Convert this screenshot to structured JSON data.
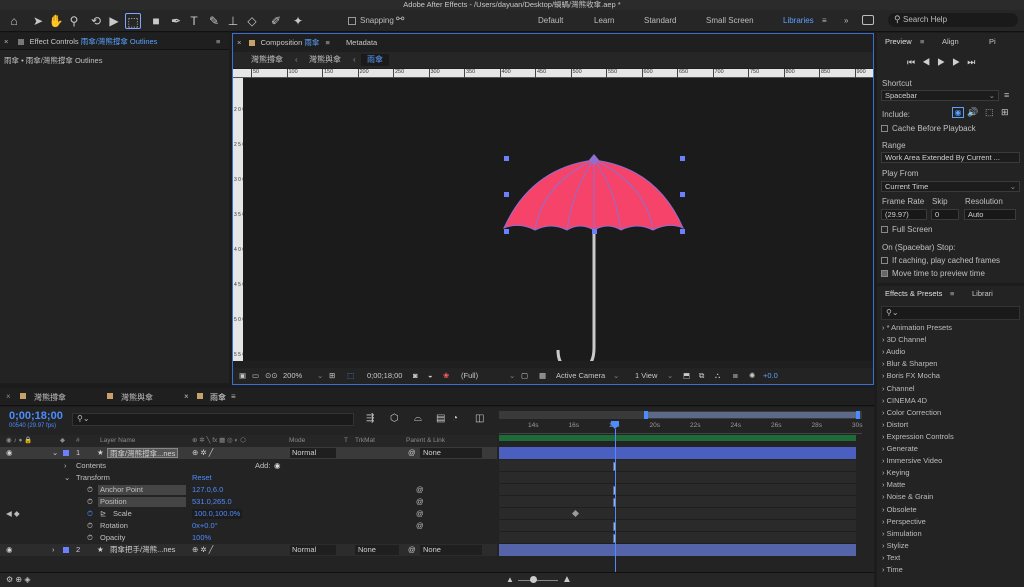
{
  "window": {
    "title": "Adobe After Effects - /Users/dayuan/Desktop/蝸蝸/灣熊收傘.aep *"
  },
  "toolbar": {
    "snapping_label": "Snapping",
    "workspaces": [
      "Default",
      "Learn",
      "Standard",
      "Small Screen",
      "Libraries"
    ],
    "active_workspace": "Libraries",
    "search_placeholder": "Search Help"
  },
  "effect_controls": {
    "tab_label": "Effect Controls",
    "tab_layer": "雨傘/灣熊撐傘 Outlines",
    "subtitle": "雨傘 • 雨傘/灣熊撐傘 Outlines"
  },
  "composition": {
    "tab_label": "Composition",
    "tab_comp": "雨傘",
    "metadata_tab": "Metadata",
    "breadcrumbs": [
      "灣熊撐傘",
      "灣熊與傘",
      "雨傘"
    ],
    "ruler_ticks": [
      "50",
      "100",
      "150",
      "200",
      "250",
      "300",
      "350",
      "400",
      "450",
      "500",
      "550",
      "600",
      "650",
      "700",
      "750",
      "800",
      "850",
      "900"
    ],
    "vruler_ticks": [
      "2 0 0",
      "2 5 0",
      "3 0 0",
      "3 5 0",
      "4 0 0",
      "4 5 0",
      "5 0 0",
      "5 5 0"
    ],
    "zoom": "200%",
    "timecode": "0;00;18;00",
    "resolution": "(Full)",
    "camera": "Active Camera",
    "view": "1 View",
    "exposure": "+0.0"
  },
  "preview": {
    "tabs": [
      "Preview",
      "Align",
      "Pi"
    ],
    "shortcut_label": "Shortcut",
    "shortcut_value": "Spacebar",
    "include_label": "Include:",
    "cache_label": "Cache Before Playback",
    "range_label": "Range",
    "range_value": "Work Area Extended By Current ...",
    "play_from_label": "Play From",
    "play_from_value": "Current Time",
    "frame_rate_label": "Frame Rate",
    "skip_label": "Skip",
    "resolution_label": "Resolution",
    "frame_rate_value": "(29.97)",
    "skip_value": "0",
    "resolution_value": "Auto",
    "full_screen_label": "Full Screen",
    "stop_label": "On (Spacebar) Stop:",
    "if_caching_label": "If caching, play cached frames",
    "move_time_label": "Move time to preview time"
  },
  "effects": {
    "tabs": [
      "Effects & Presets",
      "Librari"
    ],
    "items": [
      "* Animation Presets",
      "3D Channel",
      "Audio",
      "Blur & Sharpen",
      "Boris FX Mocha",
      "Channel",
      "CINEMA 4D",
      "Color Correction",
      "Distort",
      "Expression Controls",
      "Generate",
      "Immersive Video",
      "Keying",
      "Matte",
      "Noise & Grain",
      "Obsolete",
      "Perspective",
      "Simulation",
      "Stylize",
      "Text",
      "Time"
    ]
  },
  "timeline": {
    "tabs": [
      "灣熊撐傘",
      "灣熊與傘",
      "雨傘"
    ],
    "current_time": "0;00;18;00",
    "frame_info": "00540 (29.97 fps)",
    "ruler": [
      "14s",
      "16s",
      "18s",
      "20s",
      "22s",
      "24s",
      "26s",
      "28s",
      "30s"
    ],
    "col_headers": {
      "num": "#",
      "layer": "Layer Name",
      "mode": "Mode",
      "t": "T",
      "trkmat": "TrkMat",
      "parent": "Parent & Link"
    },
    "layers": [
      {
        "num": "1",
        "name": "雨傘/灣熊撐傘...nes",
        "mode": "Normal",
        "trkmat": "",
        "parent": "None"
      },
      {
        "num": "2",
        "name": "雨傘把手/灣熊...nes",
        "mode": "Normal",
        "trkmat": "None",
        "parent": "None"
      }
    ],
    "contents_label": "Contents",
    "add_label": "Add:",
    "transform_label": "Transform",
    "reset_label": "Reset",
    "props": [
      {
        "name": "Anchor Point",
        "value": "127.0,6.0"
      },
      {
        "name": "Position",
        "value": "531.0,265.0"
      },
      {
        "name": "Scale",
        "value": "100.0,100.0%"
      },
      {
        "name": "Rotation",
        "value": "0x+0.0°"
      },
      {
        "name": "Opacity",
        "value": "100%"
      }
    ]
  },
  "colors": {
    "accent": "#4d8cff",
    "umbrella": "#f5436a",
    "canopy_line": "#8f6fd0"
  }
}
